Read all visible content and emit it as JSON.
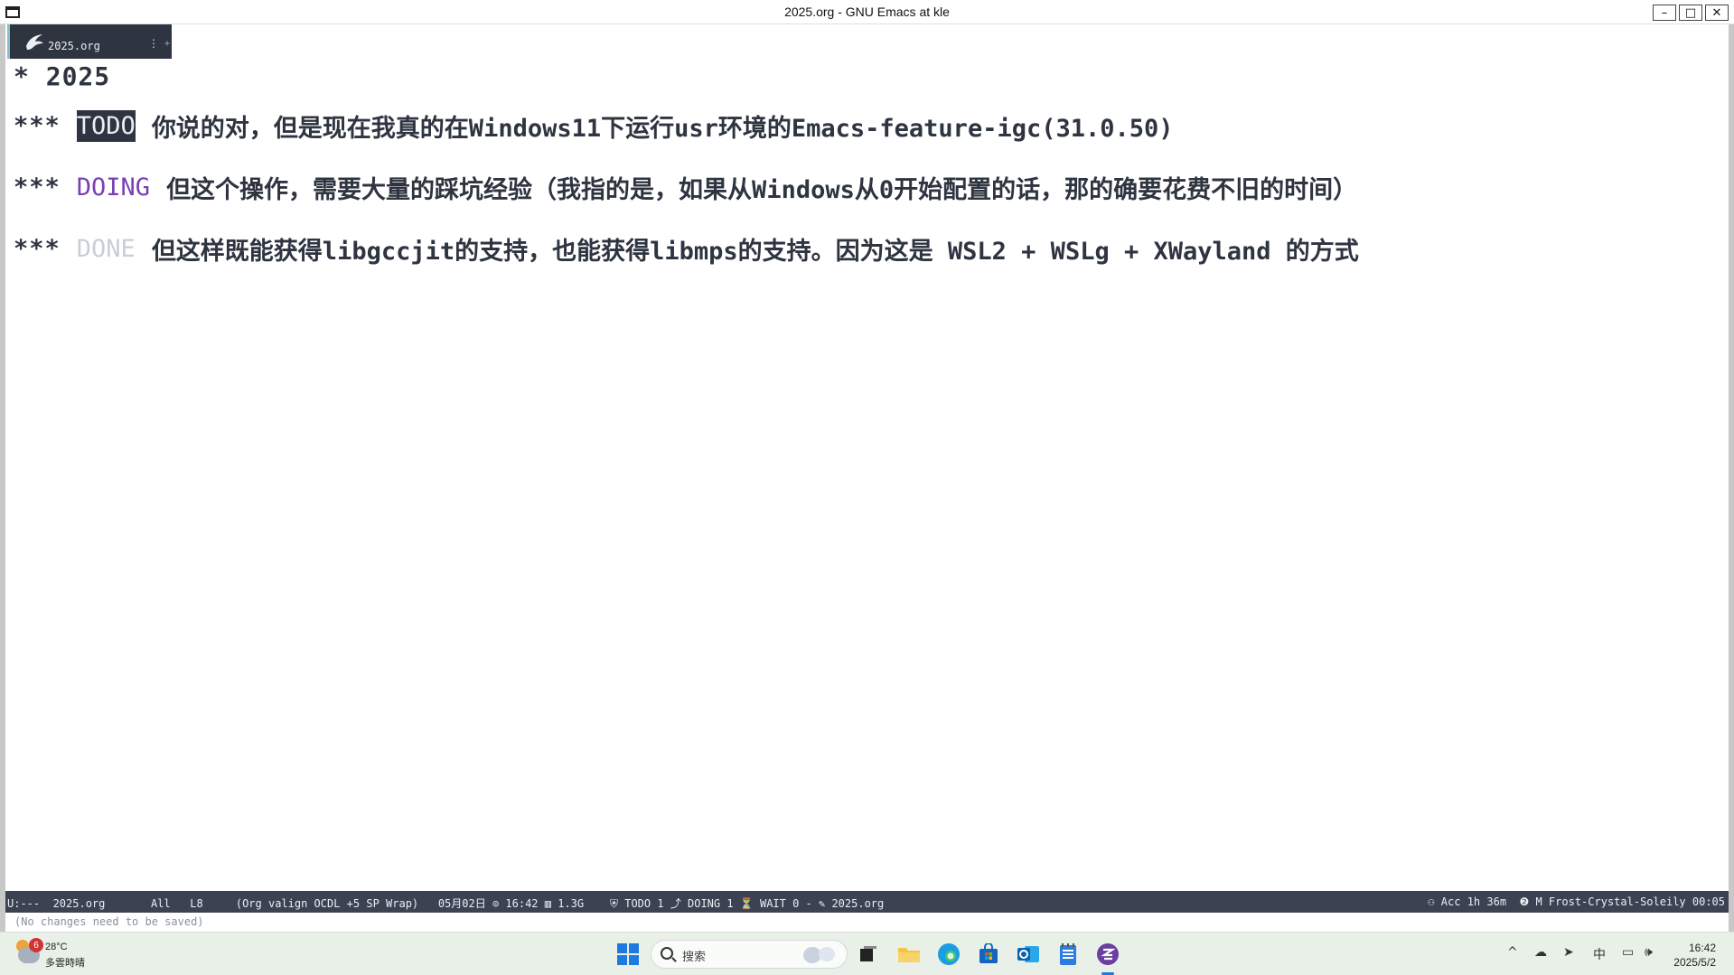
{
  "window": {
    "title": "2025.org - GNU Emacs at kle",
    "minimize_glyph": "–",
    "maximize_glyph": "□",
    "close_glyph": "✕"
  },
  "tab": {
    "label": "2025.org",
    "icon": "emacs-icon"
  },
  "buffer": {
    "heading": "* 2025",
    "lines": [
      {
        "stars": "***",
        "keyword": "TODO",
        "text": "你说的对，但是现在我真的在Windows11下运行usr环境的Emacs-feature-igc(31.0.50)"
      },
      {
        "stars": "***",
        "keyword": "DOING",
        "text": "但这个操作，需要大量的踩坑经验（我指的是，如果从Windows从0开始配置的话，那的确要花费不旧的时间）"
      },
      {
        "stars": "***",
        "keyword": "DONE",
        "text": "但这样既能获得libgccjit的支持，也能获得libmps的支持。因为这是 WSL2 + WSLg + XWayland 的方式"
      }
    ]
  },
  "modeline": {
    "left": "U:---  2025.org       All   L8     (Org valign OCDL +5 SP Wrap)   05月02日 ⊙ 16:42 ▥ 1.3G    ⛨ TODO 1 ⤴ DOING 1 ⏳ WAIT 0 - ✎ 2025.org",
    "right": "⚇ Acc 1h 36m  ❷ M Frost-Crystal-Soleily 00:05"
  },
  "echo_area": {
    "message": "(No changes need to be saved)"
  },
  "taskbar": {
    "weather_badge": "6",
    "weather_temp": "28°C",
    "weather_desc": "多雲時晴",
    "search_placeholder": "搜索",
    "tray_ime": "中",
    "clock_time": "16:42",
    "clock_date": "2025/5/2"
  },
  "colors": {
    "todo_bg": "#2e3440",
    "doing": "#7b3fb4",
    "done": "#c8ced8",
    "modeline_bg": "#3b4252",
    "taskbar_bg": "#e8f0e8"
  }
}
